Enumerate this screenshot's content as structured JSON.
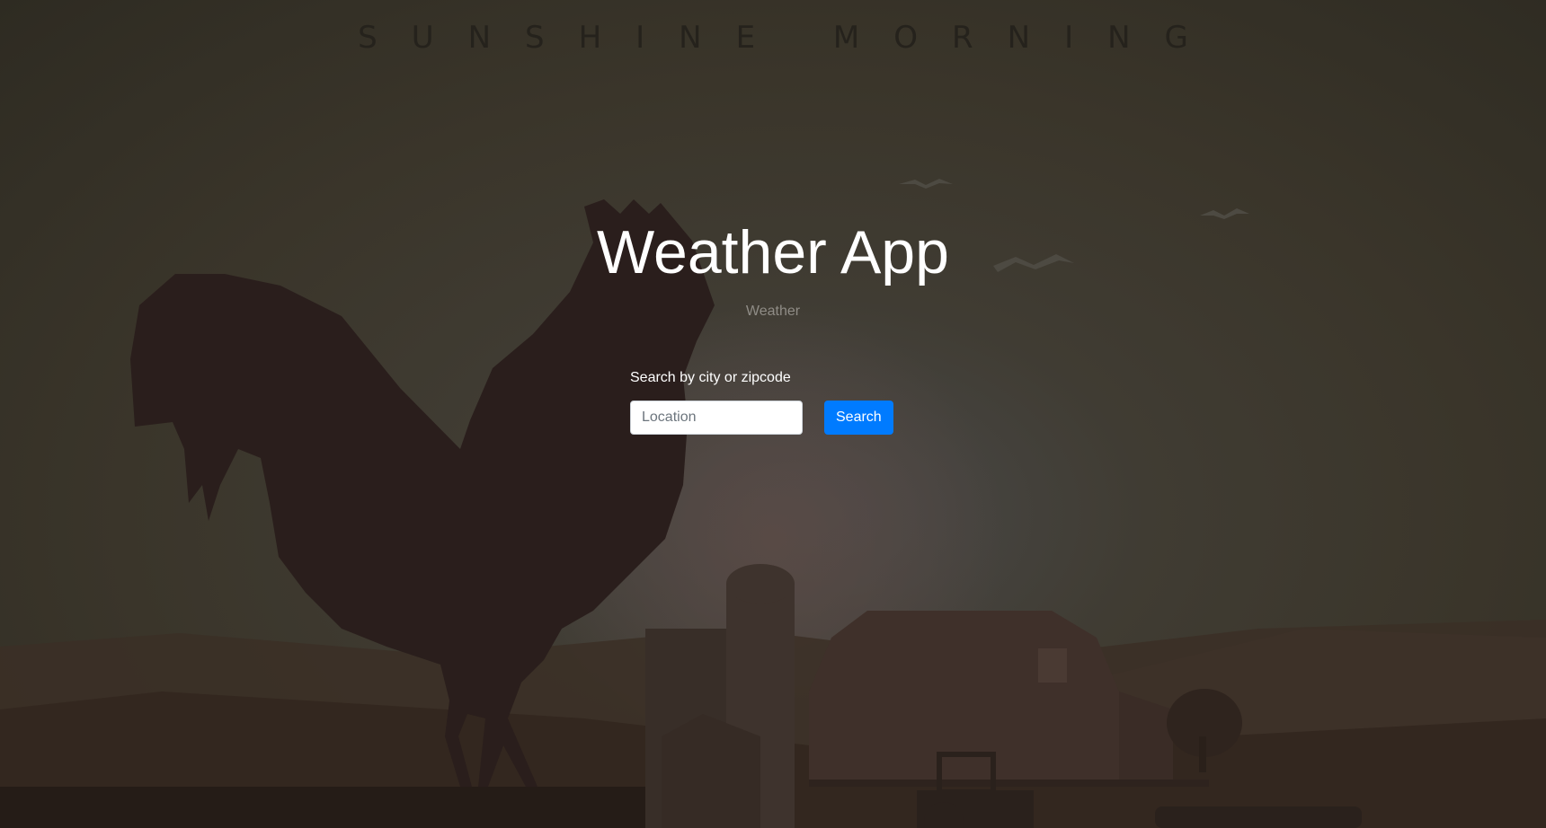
{
  "banner": {
    "text": "SUNSHINE MORNING"
  },
  "hero": {
    "title": "Weather App",
    "subtitle": "Weather"
  },
  "search": {
    "label": "Search by city or zipcode",
    "input_value": "",
    "placeholder": "Location",
    "button_label": "Search"
  },
  "colors": {
    "button_bg": "#007bff",
    "title_text": "#ffffff",
    "subtitle_text": "#8f8c86",
    "background": "#3a352a"
  },
  "icons": [
    "rooster-illustration",
    "barn-illustration",
    "silo-illustration",
    "tractor-illustration",
    "birds-illustration",
    "tree-illustration"
  ]
}
